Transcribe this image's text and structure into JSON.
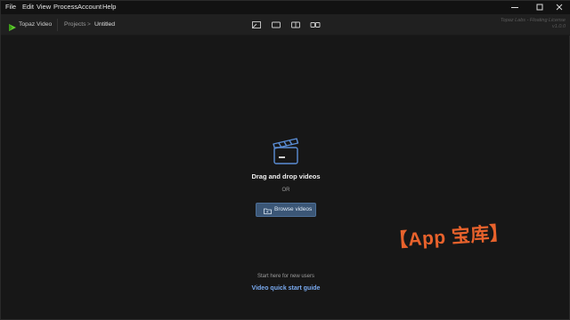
{
  "menu": {
    "items": [
      {
        "label": "File"
      },
      {
        "label": "Edit"
      },
      {
        "label": "View"
      },
      {
        "label": "Process"
      },
      {
        "label": "Account"
      },
      {
        "label": "Help"
      }
    ],
    "window_controls": [
      "minimize-icon",
      "maximize-icon",
      "close-icon"
    ]
  },
  "header": {
    "app_name": "Topaz Video",
    "breadcrumb": {
      "projects": "Projects",
      "separator": ">",
      "current": "Untitled"
    },
    "view_modes": [
      "single-view-icon",
      "full-view-icon",
      "split-view-icon",
      "side-by-side-icon"
    ],
    "license_line1": "Topaz Labs - Floating License",
    "license_line2": "v1.0.0",
    "brand_color": "#5fce2f"
  },
  "drop_zone": {
    "icon": "clapperboard-icon",
    "title": "Drag and drop videos",
    "or_text": "OR",
    "browse_label": "Browse videos",
    "browse_icon": "folder-video-icon"
  },
  "watermark": "【App 宝库】",
  "footer": {
    "start_text": "Start here for new users",
    "guide_link": "Video quick start guide"
  }
}
